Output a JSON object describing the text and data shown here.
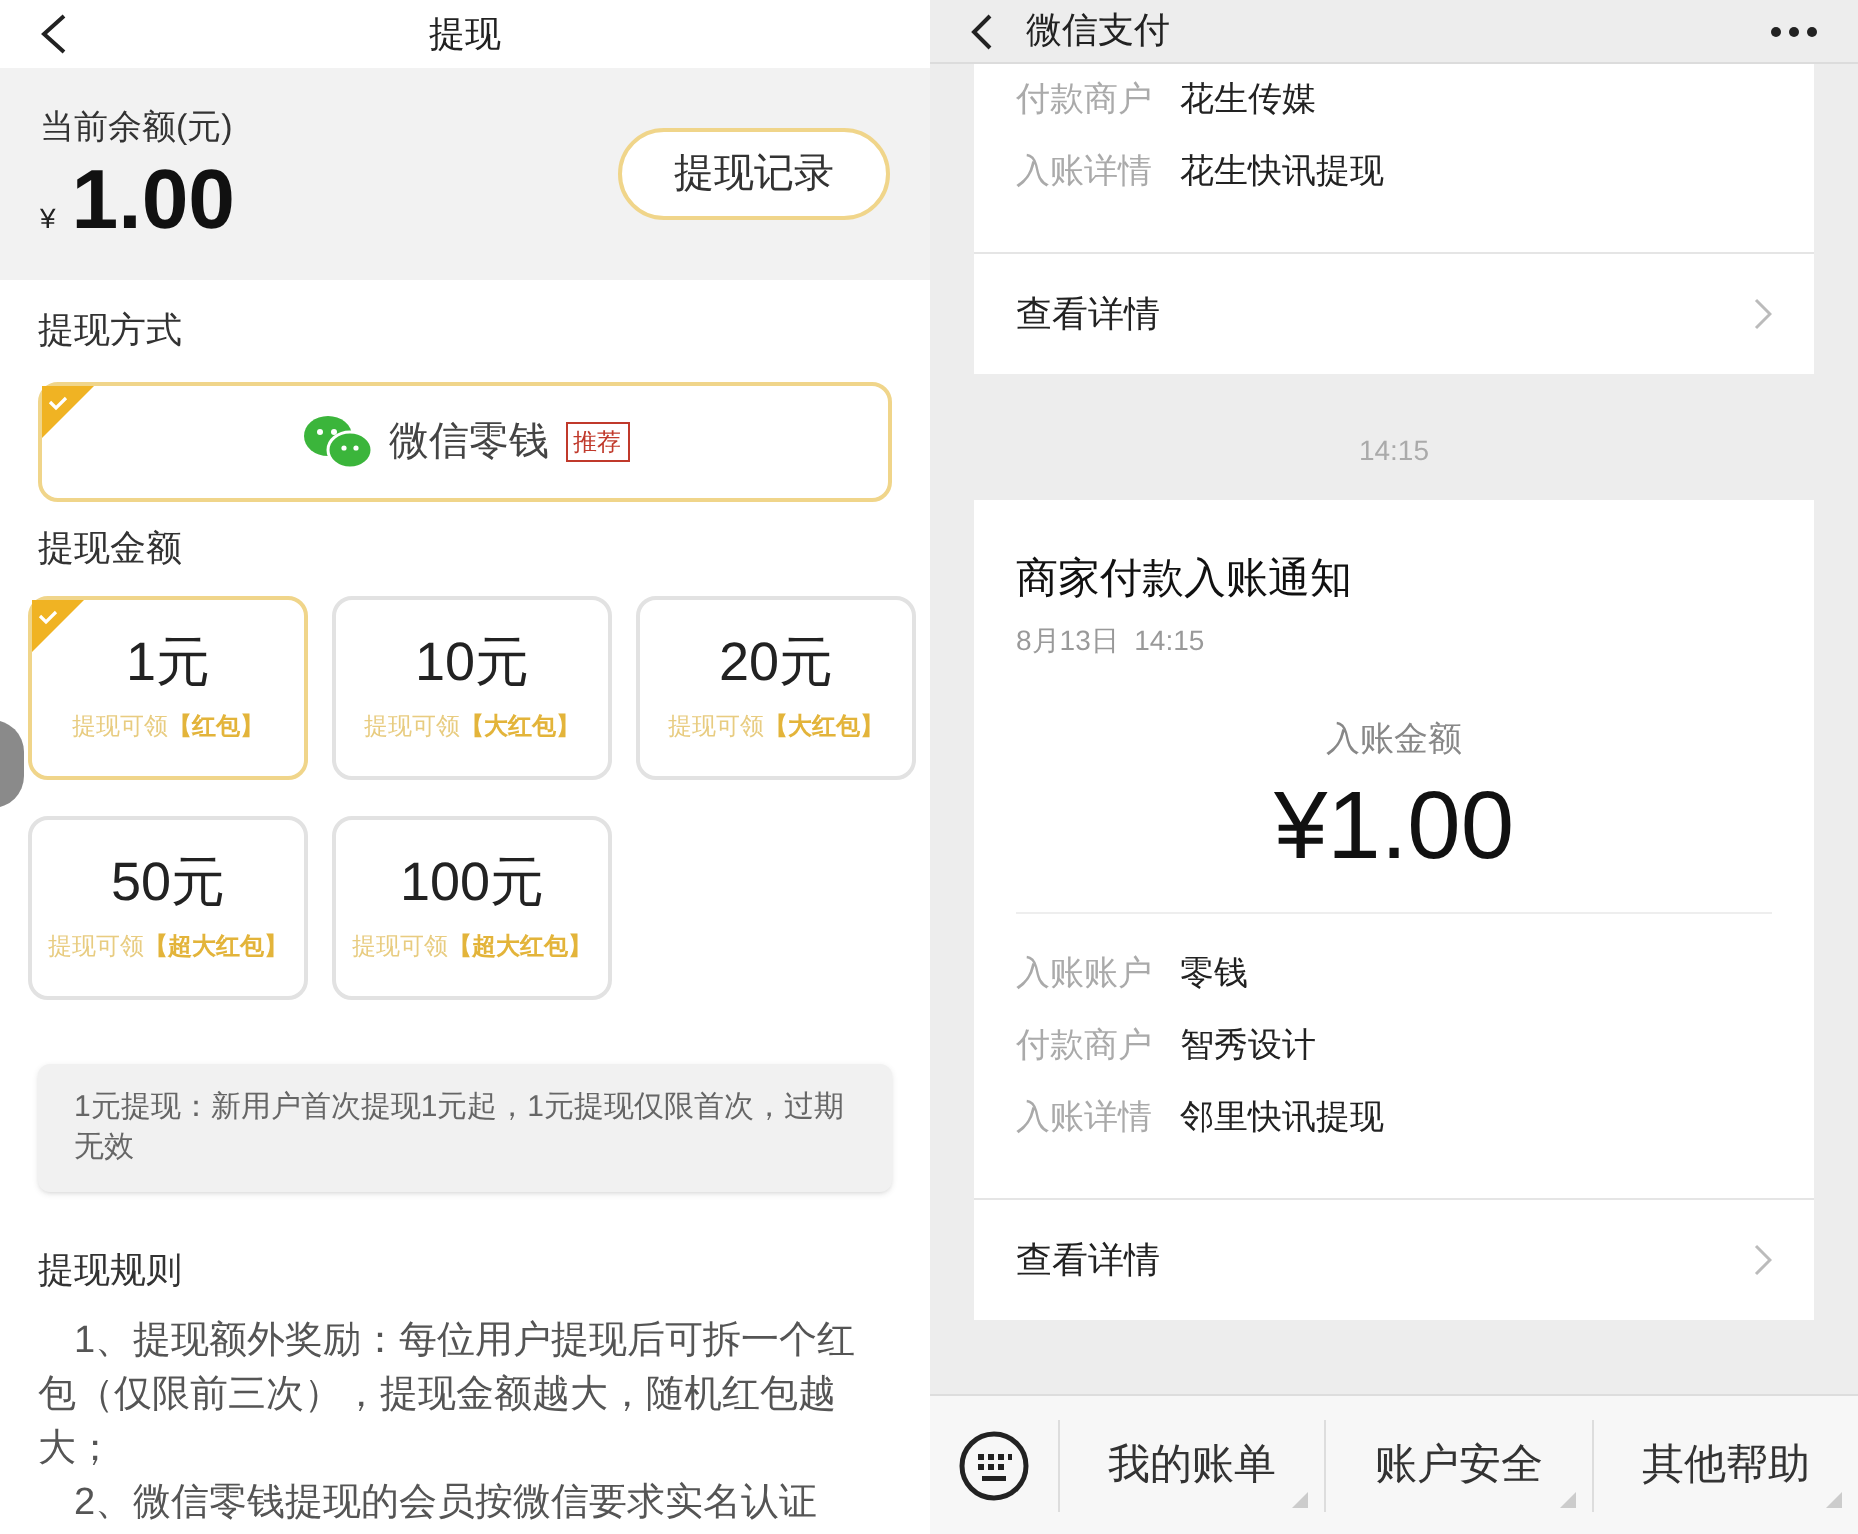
{
  "withdraw": {
    "title": "提现",
    "balance_label": "当前余额(元)",
    "currency": "¥",
    "balance": "1.00",
    "history_button": "提现记录",
    "method_label": "提现方式",
    "methods": [
      {
        "label": "微信零钱",
        "badge": "推荐",
        "selected": true
      }
    ],
    "amount_label": "提现金额",
    "amounts": [
      {
        "value": "1元",
        "hint": "提现可领",
        "bonus": "【红包】",
        "selected": true
      },
      {
        "value": "10元",
        "hint": "提现可领",
        "bonus": "【大红包】",
        "selected": false
      },
      {
        "value": "20元",
        "hint": "提现可领",
        "bonus": "【大红包】",
        "selected": false
      },
      {
        "value": "50元",
        "hint": "提现可领",
        "bonus": "【超大红包】",
        "selected": false
      },
      {
        "value": "100元",
        "hint": "提现可领",
        "bonus": "【超大红包】",
        "selected": false
      }
    ],
    "notice": "1元提现：新用户首次提现1元起，1元提现仅限首次，过期无效",
    "rules_label": "提现规则",
    "rules": [
      "1、提现额外奖励：每位用户提现后可拆一个红包（仅限前三次），提现金额越大，随机红包越大；",
      "2、微信零钱提现的会员按微信要求实名认证"
    ]
  },
  "wechat_pay": {
    "title": "微信支付",
    "cards": [
      {
        "rows": [
          {
            "label": "付款商户",
            "value": "花生传媒"
          },
          {
            "label": "入账详情",
            "value": "花生快讯提现"
          }
        ],
        "link": "查看详情"
      },
      {
        "time": "14:15",
        "title": "商家付款入账通知",
        "date": "8月13日  14:15",
        "amount_label": "入账金额",
        "amount": "¥1.00",
        "rows": [
          {
            "label": "入账账户",
            "value": "零钱"
          },
          {
            "label": "付款商户",
            "value": "智秀设计"
          },
          {
            "label": "入账详情",
            "value": "邻里快讯提现"
          }
        ],
        "link": "查看详情"
      }
    ],
    "menu": [
      "我的账单",
      "账户安全",
      "其他帮助"
    ]
  }
}
